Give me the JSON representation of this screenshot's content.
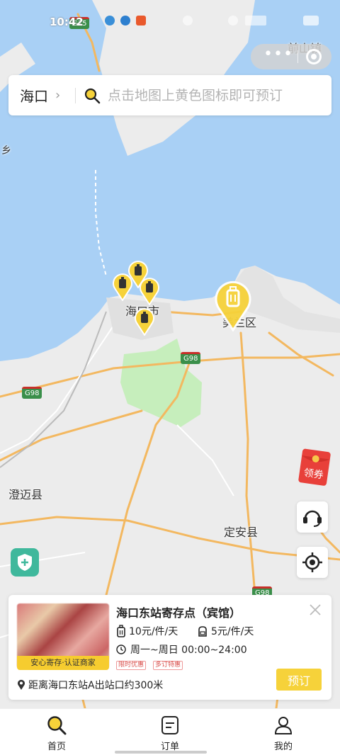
{
  "status_bar": {
    "time": "10:42"
  },
  "map": {
    "place_labels": [
      {
        "id": "qianshan",
        "text": "前山镇"
      },
      {
        "id": "xiang",
        "text": "乡"
      },
      {
        "id": "haikou",
        "text": "海口市"
      },
      {
        "id": "district",
        "text": "美兰区"
      },
      {
        "id": "chengmai",
        "text": "澄迈县"
      },
      {
        "id": "ding_an",
        "text": "定安县"
      }
    ],
    "highway_labels": [
      "G98",
      "G98",
      "G98",
      "G15"
    ]
  },
  "search": {
    "city": "海口",
    "placeholder": "点击地图上黄色图标即可预订"
  },
  "floating": {
    "coupon_label": "领券"
  },
  "store_card": {
    "name": "海口东站寄存点（宾馆）",
    "image_badge": "安心寄存·认证商家",
    "price_large": "10元/件/天",
    "price_small": "5元/件/天",
    "hours": "周一~周日 00:00~24:00",
    "tags": [
      "限时优惠",
      "多订特惠"
    ],
    "distance": "距离海口东站A出站口约300米",
    "book_label": "预订"
  },
  "bottom_nav": {
    "items": [
      {
        "label": "首页",
        "icon": "search-icon",
        "active": true
      },
      {
        "label": "订单",
        "icon": "order-icon",
        "active": false
      },
      {
        "label": "我的",
        "icon": "user-icon",
        "active": false
      }
    ]
  },
  "colors": {
    "accent": "#f6d23a",
    "water": "#a9d0f5",
    "land": "#ececec",
    "green_area": "#c6eebc",
    "road": "#f3b860"
  }
}
